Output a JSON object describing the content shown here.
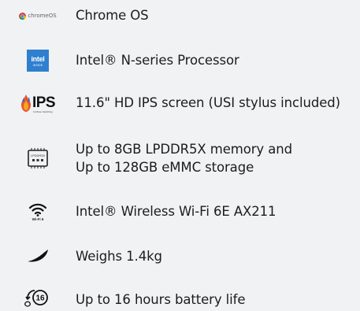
{
  "colors": {
    "background": "#f1f2f3",
    "text": "#1c1c1c",
    "intel_blue": "#2f7fd0",
    "ips_orange": "#e4572e"
  },
  "specs": [
    {
      "icon": "chrome-os-logo-icon",
      "icon_text": "chromeOS",
      "lines": [
        "Chrome OS"
      ]
    },
    {
      "icon": "intel-logo-icon",
      "icon_text": "intel",
      "icon_subtext": "INSIDE",
      "lines": [
        "Intel® N-series Processor"
      ]
    },
    {
      "icon": "ips-logo-icon",
      "icon_text": "IPS",
      "icon_subtext": "In-Plane Switching",
      "lines": [
        "11.6\" HD IPS screen (USI stylus included)"
      ]
    },
    {
      "icon": "memory-chip-icon",
      "icon_text": "LPDDR5X",
      "lines": [
        "Up to 8GB LPDDR5X memory and",
        "Up to 128GB eMMC storage"
      ]
    },
    {
      "icon": "wifi-6-icon",
      "icon_text": "Wi-Fi 6",
      "lines": [
        "Intel® Wireless Wi-Fi 6E AX211"
      ]
    },
    {
      "icon": "feather-icon",
      "lines": [
        "Weighs 1.4kg"
      ]
    },
    {
      "icon": "battery-16-hours-icon",
      "icon_text": "16",
      "lines": [
        "Up to 16 hours battery life"
      ]
    }
  ]
}
